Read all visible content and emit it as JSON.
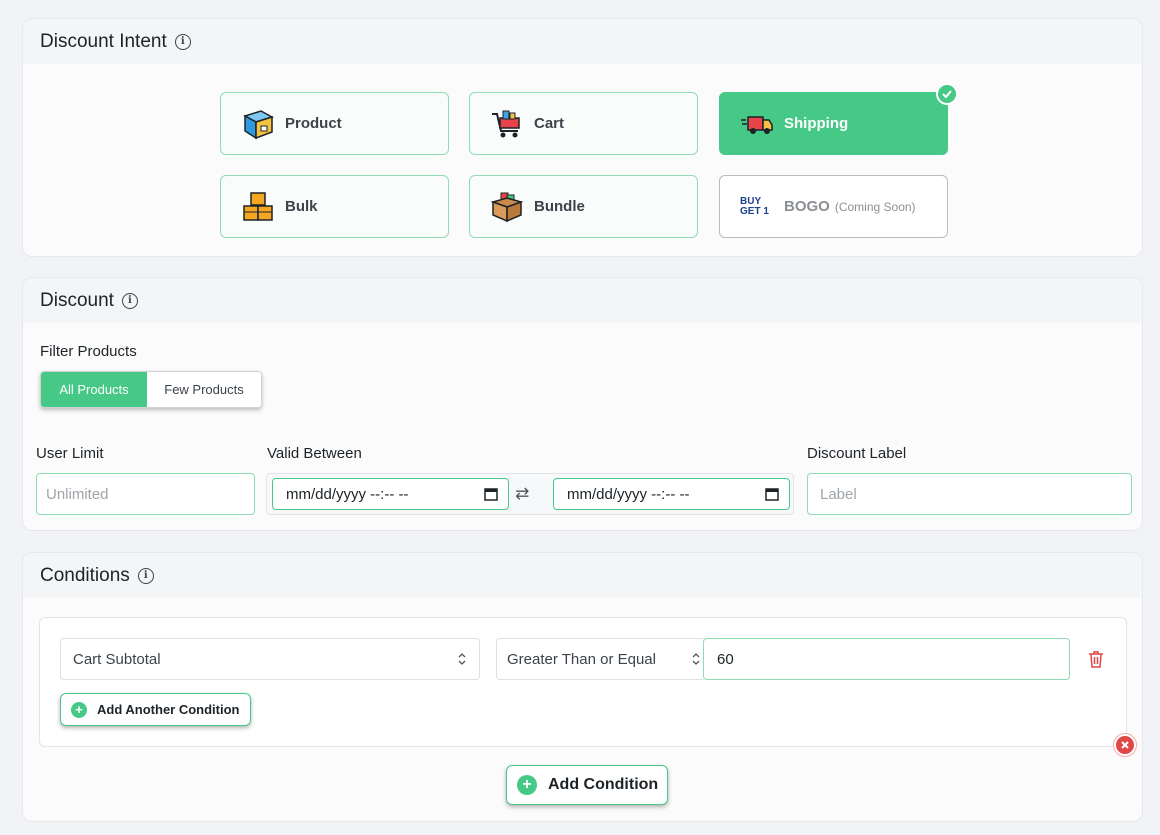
{
  "intent": {
    "title": "Discount Intent",
    "options": [
      {
        "label": "Product",
        "icon": "product-box-icon"
      },
      {
        "label": "Cart",
        "icon": "shopping-cart-icon"
      },
      {
        "label": "Shipping",
        "icon": "delivery-truck-icon",
        "selected": true
      },
      {
        "label": "Bulk",
        "icon": "stacked-boxes-icon"
      },
      {
        "label": "Bundle",
        "icon": "open-box-icon"
      },
      {
        "label": "BOGO",
        "note": "(Coming Soon)",
        "icon": "buy-get-icon",
        "disabled": true
      }
    ],
    "bogo_icon_text": "BUY GET 1"
  },
  "discount": {
    "title": "Discount",
    "filter_label": "Filter Products",
    "filter_options": [
      "All Products",
      "Few Products"
    ],
    "filter_selected": "All Products",
    "user_limit_label": "User Limit",
    "user_limit_placeholder": "Unlimited",
    "valid_between_label": "Valid Between",
    "date_from": "mm/dd/yyyy --:-- --",
    "date_to": "mm/dd/yyyy --:-- --",
    "discount_label_label": "Discount Label",
    "discount_label_placeholder": "Label"
  },
  "conditions": {
    "title": "Conditions",
    "type_value": "Cart Subtotal",
    "operator_value": "Greater Than or Equal",
    "amount_value": "60",
    "add_another_label": "Add Another Condition",
    "add_condition_label": "Add Condition"
  },
  "colors": {
    "accent": "#46c987",
    "danger": "#e04848"
  }
}
